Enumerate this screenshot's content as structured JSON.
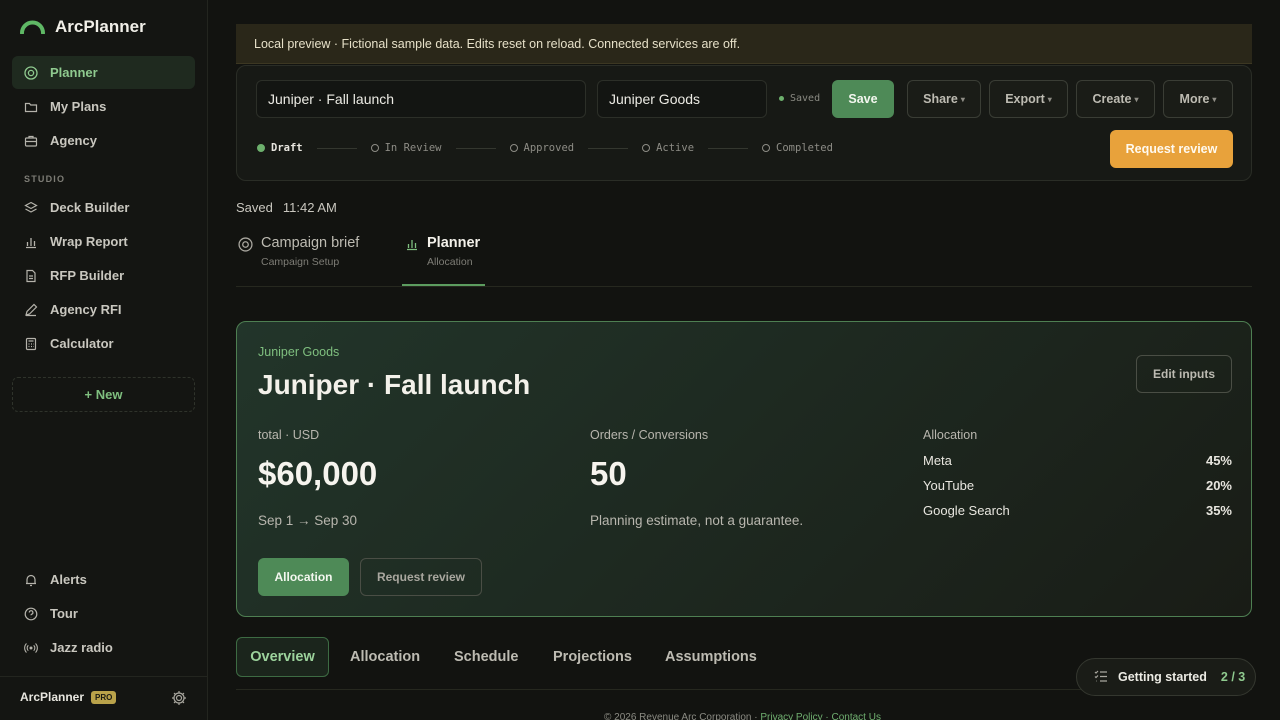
{
  "app": {
    "name": "ArcPlanner",
    "accent": "#4e8a57",
    "warning": "#e8a23b"
  },
  "sidebar": {
    "main_items": [
      {
        "label": "Planner",
        "icon": "target-icon",
        "active": true
      },
      {
        "label": "My Plans",
        "icon": "folder-icon"
      },
      {
        "label": "Agency",
        "icon": "briefcase-icon"
      }
    ],
    "section_label": "STUDIO",
    "studio_items": [
      {
        "label": "Deck Builder",
        "icon": "layers-icon"
      },
      {
        "label": "Wrap Report",
        "icon": "bar-chart-icon"
      },
      {
        "label": "RFP Builder",
        "icon": "document-icon"
      },
      {
        "label": "Agency RFI",
        "icon": "pen-icon"
      },
      {
        "label": "Calculator",
        "icon": "calculator-icon"
      }
    ],
    "new_label": "+ New",
    "bottom_items": [
      {
        "label": "Alerts",
        "icon": "bell-icon"
      },
      {
        "label": "Tour",
        "icon": "help-icon"
      },
      {
        "label": "Jazz radio",
        "icon": "radio-icon"
      }
    ],
    "footer": {
      "name": "ArcPlanner",
      "badge": "PRO"
    }
  },
  "banner": {
    "text": "Local preview · Fictional sample data. Edits reset on reload. Connected services are off."
  },
  "plan": {
    "name_value": "Juniper · Fall launch",
    "brand_value": "Juniper Goods",
    "saved_indicator": "Saved",
    "save_label": "Save",
    "share_label": "Share",
    "export_label": "Export",
    "create_label": "Create",
    "more_label": "More",
    "request_review_label": "Request review",
    "statuses": [
      {
        "label": "Draft",
        "active": true
      },
      {
        "label": "In Review"
      },
      {
        "label": "Approved"
      },
      {
        "label": "Active"
      },
      {
        "label": "Completed"
      }
    ]
  },
  "saved_time": {
    "label": "Saved",
    "time": "11:42 AM"
  },
  "page_tabs": [
    {
      "title": "Campaign brief",
      "subtitle": "Campaign Setup",
      "icon": "target-icon"
    },
    {
      "title": "Planner",
      "subtitle": "Allocation",
      "icon": "bar-chart-icon",
      "active": true
    }
  ],
  "summary": {
    "brand": "Juniper Goods",
    "title": "Juniper · Fall launch",
    "edit_label": "Edit inputs",
    "budget_label": "total · USD",
    "budget_value": "$60,000",
    "date_range": "Sep 1 → Sep 30",
    "orders_label": "Orders / Conversions",
    "orders_value": "50",
    "orders_note": "Planning estimate, not a guarantee.",
    "allocation_label": "Allocation",
    "allocation": [
      {
        "channel": "Meta",
        "pct": "45%"
      },
      {
        "channel": "YouTube",
        "pct": "20%"
      },
      {
        "channel": "Google Search",
        "pct": "35%"
      }
    ],
    "allocation_button": "Allocation",
    "request_review_button": "Request review"
  },
  "bottom_tabs": [
    "Overview",
    "Allocation",
    "Schedule",
    "Projections",
    "Assumptions"
  ],
  "footer": {
    "copyright": "© 2026 Revenue Arc Corporation · ",
    "privacy": "Privacy Policy",
    "sep": " · ",
    "contact": "Contact Us"
  },
  "getting_started": {
    "label": "Getting started",
    "count": "2 / 3"
  }
}
